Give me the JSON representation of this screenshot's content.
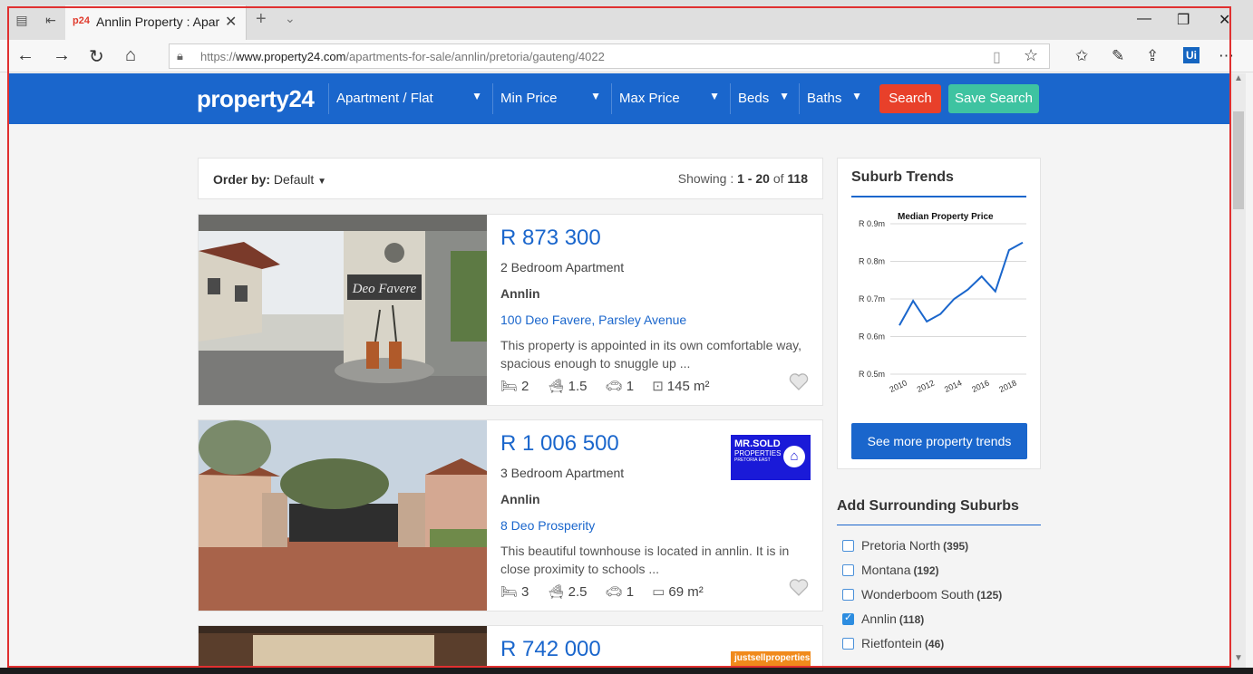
{
  "browser": {
    "tab_title": "Annlin Property : Apartr",
    "tab_favicon": "p24",
    "url_prefix": "https://",
    "url_host": "www.property24.com",
    "url_path": "/apartments-for-sale/annlin/pretoria/gauteng/4022"
  },
  "header": {
    "logo": "property24",
    "filters": [
      "Apartment / Flat",
      "Min Price",
      "Max Price",
      "Beds",
      "Baths"
    ],
    "search_label": "Search",
    "save_search_label": "Save Search",
    "search_color": "#e8402a",
    "save_color": "#3ec3a1",
    "brand_color": "#1a66cc"
  },
  "results": {
    "order_by_label": "Order by:",
    "order_by_value": "Default",
    "showing_prefix": "Showing :",
    "showing_range": "1 - 20",
    "showing_of": "of",
    "showing_total": "118"
  },
  "listings": [
    {
      "price": "R 873 300",
      "type": "2 Bedroom Apartment",
      "suburb": "Annlin",
      "address": "100 Deo Favere, Parsley Avenue",
      "description": "This property is appointed in its own comfortable way, spacious enough to snuggle up ...",
      "beds": "2",
      "baths": "1.5",
      "parking": "1",
      "size": "145 m²",
      "photo_sign": "Deo Favere"
    },
    {
      "price": "R 1 006 500",
      "type": "3 Bedroom Apartment",
      "suburb": "Annlin",
      "address": "8 Deo Prosperity",
      "description": "This beautiful townhouse is located in annlin. It is in close proximity to schools ...",
      "beds": "3",
      "baths": "2.5",
      "parking": "1",
      "size": "69 m²",
      "agency_line1": "MR.SOLD",
      "agency_line2": "PROPERTIES",
      "agency_line3": "PRETORIA EAST"
    },
    {
      "price": "R 742 000",
      "agency_logo_text": "justsellproperties"
    }
  ],
  "trends": {
    "title": "Suburb Trends",
    "button_label": "See more property trends"
  },
  "chart_data": {
    "type": "line",
    "title": "Median Property Price",
    "x": [
      2010,
      2011,
      2012,
      2013,
      2014,
      2015,
      2016,
      2017,
      2018,
      2019
    ],
    "series": [
      {
        "values": [
          0.63,
          0.695,
          0.64,
          0.66,
          0.7,
          0.725,
          0.76,
          0.72,
          0.83,
          0.85
        ]
      }
    ],
    "x_ticks": [
      "2010",
      "2012",
      "2014",
      "2016",
      "2018"
    ],
    "y_ticks": [
      "R 0.5m",
      "R 0.6m",
      "R 0.7m",
      "R 0.8m",
      "R 0.9m"
    ],
    "ylim": [
      0.5,
      0.9
    ],
    "grid": true,
    "line_color": "#1a66cc"
  },
  "surrounding": {
    "title": "Add Surrounding Suburbs",
    "items": [
      {
        "name": "Pretoria North",
        "count": "(395)",
        "checked": false
      },
      {
        "name": "Montana",
        "count": "(192)",
        "checked": false
      },
      {
        "name": "Wonderboom South",
        "count": "(125)",
        "checked": false
      },
      {
        "name": "Annlin",
        "count": "(118)",
        "checked": true
      },
      {
        "name": "Rietfontein",
        "count": "(46)",
        "checked": false
      }
    ]
  }
}
